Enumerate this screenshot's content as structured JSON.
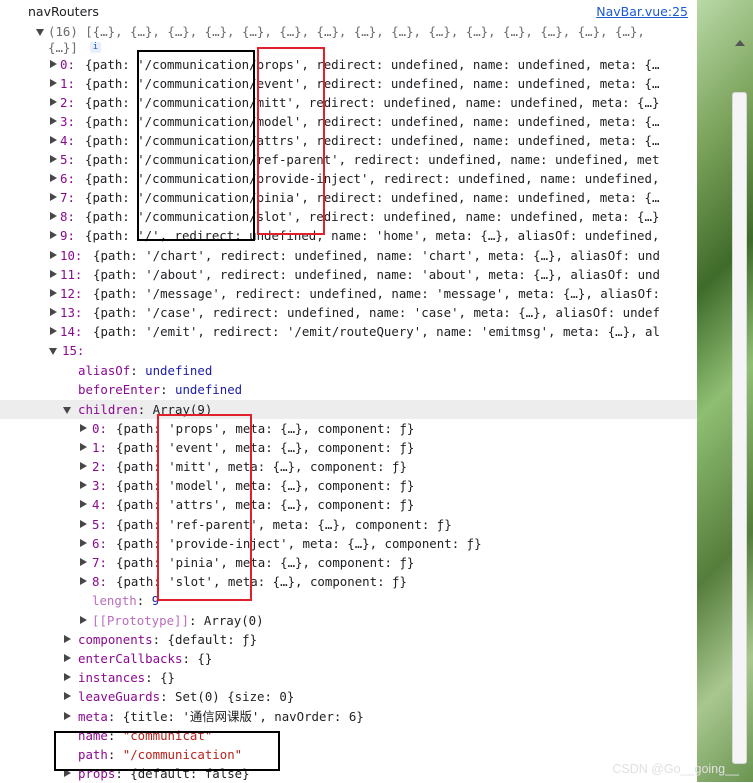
{
  "header": {
    "title": "navRouters",
    "source_link": "NavBar.vue:25"
  },
  "colors": {
    "box_black": "#000000",
    "box_red": "#e0202a",
    "string": "#b8221b",
    "keyword": "#1d1da8",
    "property": "#8b0a91"
  },
  "lines": [
    {
      "text": "(16) [{…}, {…}, {…}, {…}, {…}, {…}, {…}, {…}, {…}, {…}, {…}, {…}, {…}, {…}, {…},"
    },
    {
      "text": "{…}]"
    },
    {
      "index": "0:",
      "text": "{path: '/communication/props', redirect: undefined, name: undefined, meta: {…"
    },
    {
      "index": "1:",
      "text": "{path: '/communication/event', redirect: undefined, name: undefined, meta: {…"
    },
    {
      "index": "2:",
      "text": "{path: '/communication/mitt', redirect: undefined, name: undefined, meta: {…}"
    },
    {
      "index": "3:",
      "text": "{path: '/communication/model', redirect: undefined, name: undefined, meta: {…"
    },
    {
      "index": "4:",
      "text": "{path: '/communication/attrs', redirect: undefined, name: undefined, meta: {…"
    },
    {
      "index": "5:",
      "text": "{path: '/communication/ref-parent', redirect: undefined, name: undefined, met"
    },
    {
      "index": "6:",
      "text": "{path: '/communication/provide-inject', redirect: undefined, name: undefined,"
    },
    {
      "index": "7:",
      "text": "{path: '/communication/pinia', redirect: undefined, name: undefined, meta: {…"
    },
    {
      "index": "8:",
      "text": "{path: '/communication/slot', redirect: undefined, name: undefined, meta: {…}"
    },
    {
      "index": "9:",
      "text": "{path: '/', redirect: undefined, name: 'home', meta: {…}, aliasOf: undefined,"
    },
    {
      "index": "10:",
      "text": "{path: '/chart', redirect: undefined, name: 'chart', meta: {…}, aliasOf: und"
    },
    {
      "index": "11:",
      "text": "{path: '/about', redirect: undefined, name: 'about', meta: {…}, aliasOf: und"
    },
    {
      "index": "12:",
      "text": "{path: '/message', redirect: undefined, name: 'message', meta: {…}, aliasOf:"
    },
    {
      "index": "13:",
      "text": "{path: '/case', redirect: undefined, name: 'case', meta: {…}, aliasOf: undef"
    },
    {
      "index": "14:",
      "text": "{path: '/emit', redirect: '/emit/routeQuery', name: 'emitmsg', meta: {…}, al"
    },
    {
      "index": "15:",
      "text": ""
    },
    {
      "key": "aliasOf",
      "text": "undefined"
    },
    {
      "key": "beforeEnter",
      "text": "undefined"
    },
    {
      "key": "children",
      "text": "Array(9)"
    },
    {
      "index": "0:",
      "text": "{path: 'props', meta: {…}, component: ƒ}"
    },
    {
      "index": "1:",
      "text": "{path: 'event', meta: {…}, component: ƒ}"
    },
    {
      "index": "2:",
      "text": "{path: 'mitt', meta: {…}, component: ƒ}"
    },
    {
      "index": "3:",
      "text": "{path: 'model', meta: {…}, component: ƒ}"
    },
    {
      "index": "4:",
      "text": "{path: 'attrs', meta: {…}, component: ƒ}"
    },
    {
      "index": "5:",
      "text": "{path: 'ref-parent', meta: {…}, component: ƒ}"
    },
    {
      "index": "6:",
      "text": "{path: 'provide-inject', meta: {…}, component: ƒ}"
    },
    {
      "index": "7:",
      "text": "{path: 'pinia', meta: {…}, component: ƒ}"
    },
    {
      "index": "8:",
      "text": "{path: 'slot', meta: {…}, component: ƒ}"
    },
    {
      "key": "length",
      "text": "9"
    },
    {
      "key": "[[Prototype]]",
      "text": "Array(0)"
    },
    {
      "key": "components",
      "text": "{default: ƒ}"
    },
    {
      "key": "enterCallbacks",
      "text": "{}"
    },
    {
      "key": "instances",
      "text": "{}"
    },
    {
      "key": "leaveGuards",
      "text": "Set(0) {size: 0}"
    },
    {
      "key": "meta",
      "text": "{title: '通信网课版', navOrder: 6}"
    },
    {
      "key": "name",
      "text": "\"communicat\""
    },
    {
      "key": "path",
      "text": "\"/communication\""
    },
    {
      "key": "props",
      "text": "{default: false}"
    }
  ],
  "info_badge": "i",
  "watermark": "CSDN @Go__going__"
}
